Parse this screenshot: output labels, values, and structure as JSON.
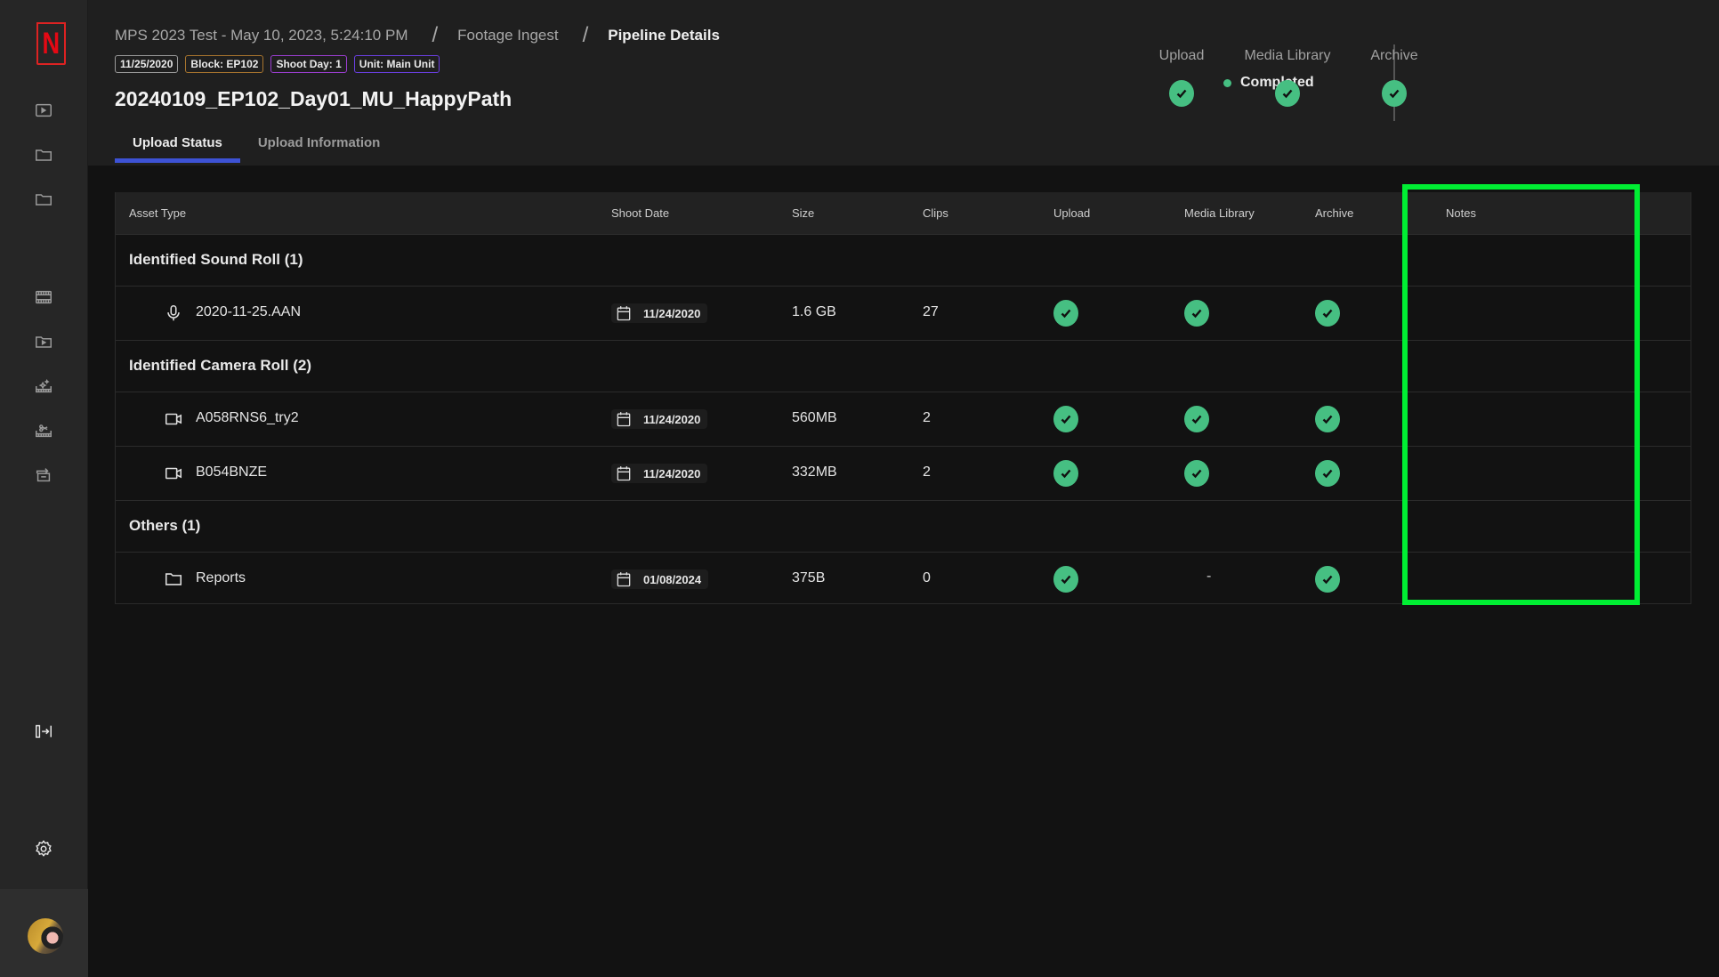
{
  "sidebar": {
    "logo": "N",
    "items": [
      {
        "name": "sidebar-item-media",
        "icon": "play-box-icon"
      },
      {
        "name": "sidebar-item-folder-1",
        "icon": "folder-icon"
      },
      {
        "name": "sidebar-item-folder-2",
        "icon": "folder-icon"
      },
      {
        "name": "sidebar-item-filmstrip",
        "icon": "filmstrip-icon"
      },
      {
        "name": "sidebar-item-media-folder",
        "icon": "play-folder-icon"
      },
      {
        "name": "sidebar-item-effects",
        "icon": "sparkle-clapper-icon"
      },
      {
        "name": "sidebar-item-edit",
        "icon": "scissors-clapper-icon"
      },
      {
        "name": "sidebar-item-archive-export",
        "icon": "archive-export-icon"
      }
    ],
    "collapse_icon": "expand-sidebar-icon",
    "settings_icon": "gear-icon"
  },
  "header": {
    "breadcrumbs": [
      "MPS 2023 Test - May 10, 2023, 5:24:10 PM",
      "Footage Ingest",
      "Pipeline Details"
    ],
    "separator": "/",
    "tags": [
      {
        "label": "11/25/2020",
        "color": "#9a9a9a"
      },
      {
        "label": "Block: EP102",
        "color": "#a7742e"
      },
      {
        "label": "Shoot Day: 1",
        "color": "#9b3ed0"
      },
      {
        "label": "Unit: Main Unit",
        "color": "#6a3fe0"
      }
    ],
    "title": "20240109_EP102_Day01_MU_HappyPath",
    "tabs": [
      {
        "label": "Upload Status",
        "active": true
      },
      {
        "label": "Upload Information",
        "active": false
      }
    ],
    "status": {
      "label": "Completed",
      "color": "#46bf82"
    },
    "stages": [
      {
        "label": "Upload",
        "state": "complete"
      },
      {
        "label": "Media Library",
        "state": "complete"
      },
      {
        "label": "Archive",
        "state": "complete"
      }
    ]
  },
  "table": {
    "columns": [
      "Asset Type",
      "Shoot Date",
      "Size",
      "Clips",
      "Upload",
      "Media Library",
      "Archive",
      "Notes"
    ],
    "groups": [
      {
        "label": "Identified Sound Roll (1)",
        "rows": [
          {
            "icon": "microphone-icon",
            "name": "2020-11-25.AAN",
            "shoot_date": "11/24/2020",
            "size": "1.6 GB",
            "clips": "27",
            "upload": "complete",
            "media_library": "complete",
            "archive": "complete",
            "notes": ""
          }
        ]
      },
      {
        "label": "Identified Camera Roll (2)",
        "rows": [
          {
            "icon": "video-camera-icon",
            "name": "A058RNS6_try2",
            "shoot_date": "11/24/2020",
            "size": "560MB",
            "clips": "2",
            "upload": "complete",
            "media_library": "complete",
            "archive": "complete",
            "notes": ""
          },
          {
            "icon": "video-camera-icon",
            "name": "B054BNZE",
            "shoot_date": "11/24/2020",
            "size": "332MB",
            "clips": "2",
            "upload": "complete",
            "media_library": "complete",
            "archive": "complete",
            "notes": ""
          }
        ]
      },
      {
        "label": "Others (1)",
        "rows": [
          {
            "icon": "folder-icon",
            "name": "Reports",
            "shoot_date": "01/08/2024",
            "size": "375B",
            "clips": "0",
            "upload": "complete",
            "media_library": "-",
            "archive": "complete",
            "notes": ""
          }
        ]
      }
    ]
  },
  "annotation": {
    "highlight_color": "#00ee33",
    "target": "Notes column"
  }
}
